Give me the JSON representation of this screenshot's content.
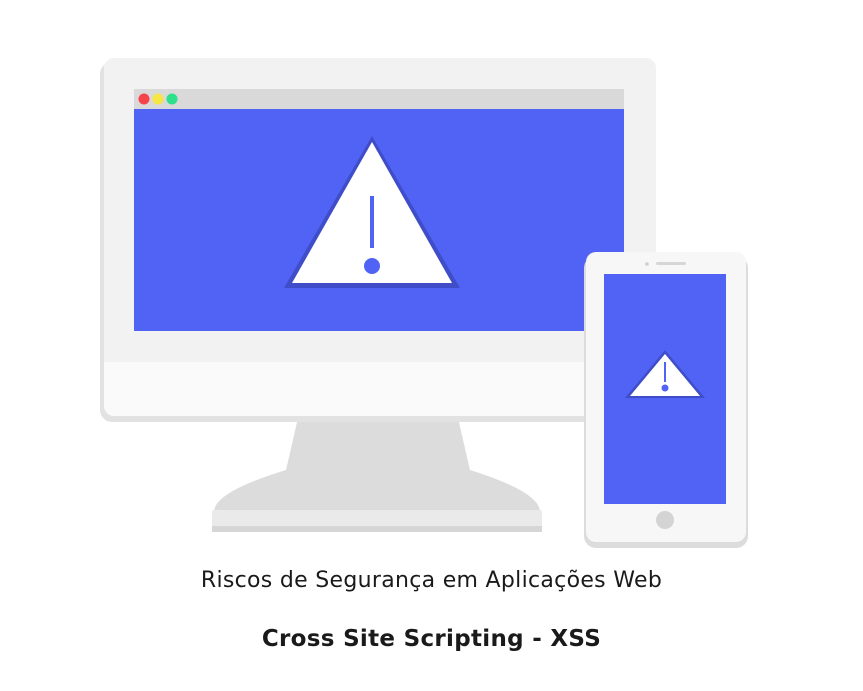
{
  "caption": {
    "subtitle": "Riscos de Segurança em Aplicações Web",
    "title": "Cross Site Scripting - XSS"
  },
  "icons": {
    "monitor": "desktop-monitor-icon",
    "phone": "smartphone-icon",
    "warning": "warning-triangle-icon"
  },
  "colors": {
    "screen": "#5163f5",
    "frame": "#f2f2f2",
    "stand": "#dcdcdc",
    "browser_bar": "#d9d9d9",
    "dot_red": "#f5424b",
    "dot_yellow": "#f5e642",
    "dot_green": "#2de08a"
  }
}
